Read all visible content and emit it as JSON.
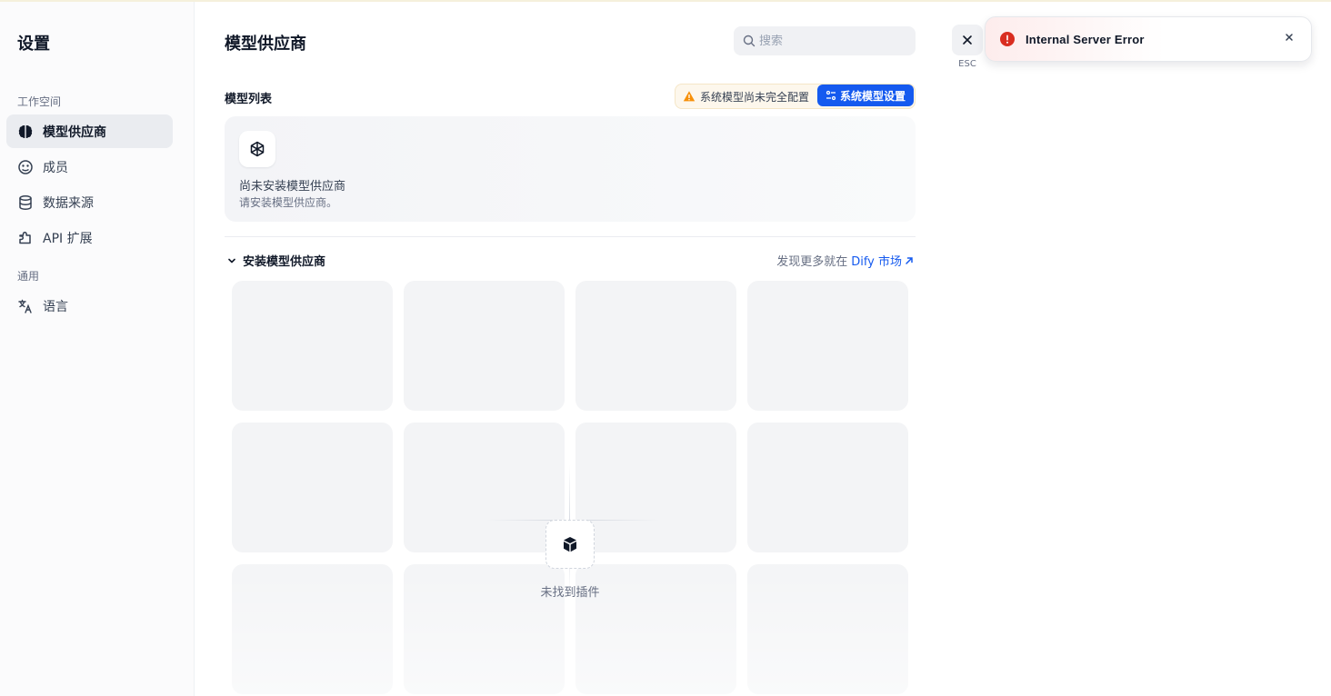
{
  "sidebar": {
    "title": "设置",
    "groups": [
      {
        "label": "工作空间"
      },
      {
        "label": "通用"
      }
    ],
    "items": [
      {
        "label": "模型供应商",
        "icon": "brain-icon",
        "active": true
      },
      {
        "label": "成员",
        "icon": "members-icon",
        "active": false
      },
      {
        "label": "数据来源",
        "icon": "database-icon",
        "active": false
      },
      {
        "label": "API 扩展",
        "icon": "puzzle-icon",
        "active": false
      },
      {
        "label": "语言",
        "icon": "translate-icon",
        "active": false
      }
    ]
  },
  "main": {
    "title": "模型供应商",
    "search": {
      "placeholder": "搜索",
      "value": ""
    },
    "model_list_label": "模型列表",
    "warning": "系统模型尚未完全配置",
    "system_model_button": "系统模型设置",
    "empty_state": {
      "title": "尚未安装模型供应商",
      "description": "请安装模型供应商。"
    },
    "install_section": {
      "label": "安装模型供应商",
      "discover_text": "发现更多就在",
      "discover_link": "Dify 市场"
    },
    "no_plugin_text": "未找到插件"
  },
  "close": {
    "esc_label": "ESC"
  },
  "toast": {
    "message": "Internal Server Error"
  },
  "colors": {
    "accent": "#155aef",
    "warning": "#f79009",
    "error": "#d92d20"
  }
}
